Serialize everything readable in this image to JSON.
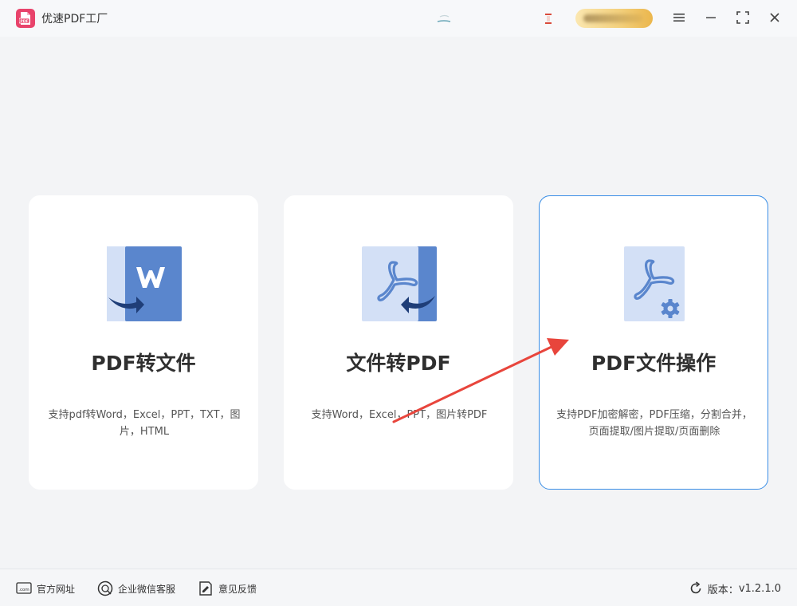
{
  "app": {
    "title": "优速PDF工厂",
    "logo_text": "PDF"
  },
  "cards": [
    {
      "title": "PDF转文件",
      "desc": "支持pdf转Word，Excel，PPT，TXT，图片，HTML"
    },
    {
      "title": "文件转PDF",
      "desc": "支持Word，Excel，PPT，图片转PDF"
    },
    {
      "title": "PDF文件操作",
      "desc": "支持PDF加密解密，PDF压缩，分割合并，页面提取/图片提取/页面删除"
    }
  ],
  "footer": {
    "website": "官方网址",
    "website_icon_text": ".com",
    "wechat": "企业微信客服",
    "feedback": "意见反馈",
    "version_label": "版本：",
    "version": "v1.2.1.0"
  },
  "colors": {
    "accent": "#3a8ee6",
    "logo": "#e8436b",
    "doc_blue": "#5a86cd",
    "doc_light": "#d3e0f6",
    "arrow": "#e8453c"
  }
}
